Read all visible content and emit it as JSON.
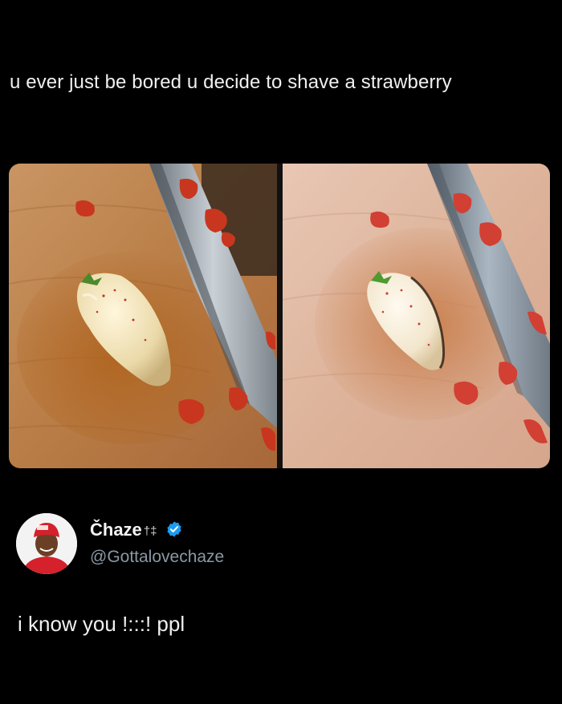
{
  "post": {
    "text": "u ever just be bored u decide to shave a strawberry"
  },
  "media": {
    "left_image_alt": "peeled white strawberry on wooden cutting board beside knife with red peelings",
    "right_image_alt": "peeled white strawberry on cutting board, brighter lighting, with knife and red peelings"
  },
  "quoted": {
    "display_name": "Čhaze",
    "name_glyph": "†‡",
    "handle": "@Gottalovechaze",
    "verified": true,
    "reply_text": "i know you !:::! ppl"
  },
  "colors": {
    "background": "#000000",
    "verified_badge": "#1d9bf0",
    "handle": "#8b98a5"
  }
}
